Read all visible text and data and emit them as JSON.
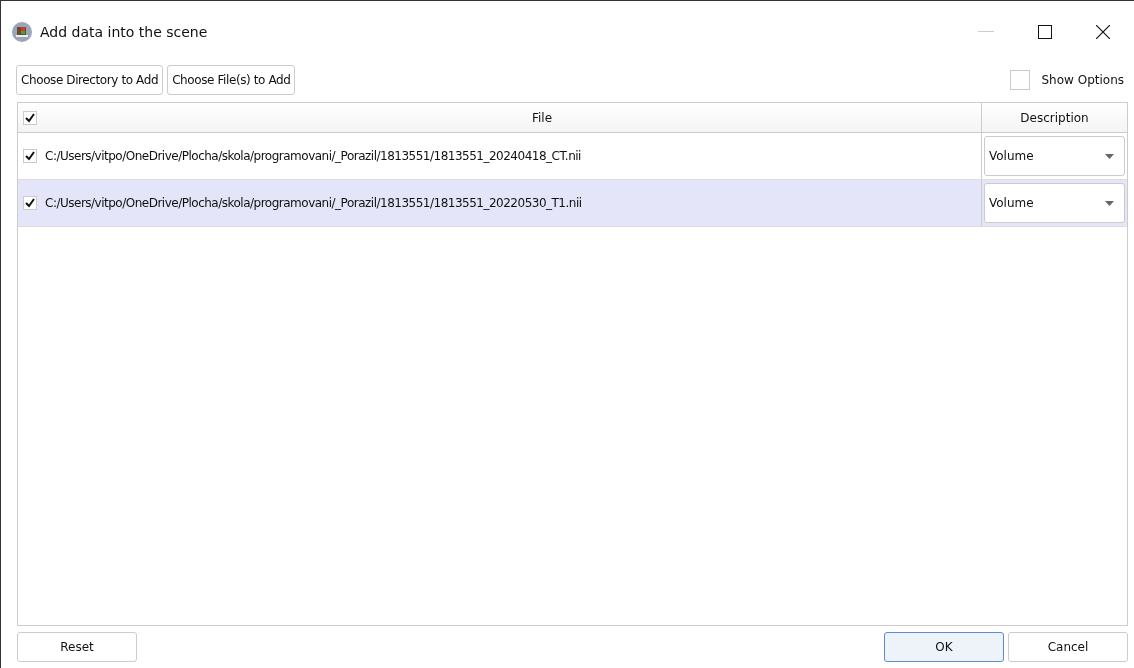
{
  "window": {
    "title": "Add data into the scene"
  },
  "toolbar": {
    "buttons": [
      "Choose Directory to Add",
      "Choose File(s) to Add"
    ],
    "show_options": {
      "label": "Show Options",
      "checked": false
    }
  },
  "table": {
    "all_checked": true,
    "columns": [
      "File",
      "Description"
    ],
    "rows": [
      {
        "checked": true,
        "selected": false,
        "file": "C:/Users/vitpo/OneDrive/Plocha/skola/programovani/_Porazil/1813551/1813551_20240418_CT.nii",
        "description": "Volume"
      },
      {
        "checked": true,
        "selected": true,
        "file": "C:/Users/vitpo/OneDrive/Plocha/skola/programovani/_Porazil/1813551/1813551_20220530_T1.nii",
        "description": "Volume"
      }
    ]
  },
  "footer": {
    "reset": "Reset",
    "ok": "OK",
    "cancel": "Cancel"
  }
}
